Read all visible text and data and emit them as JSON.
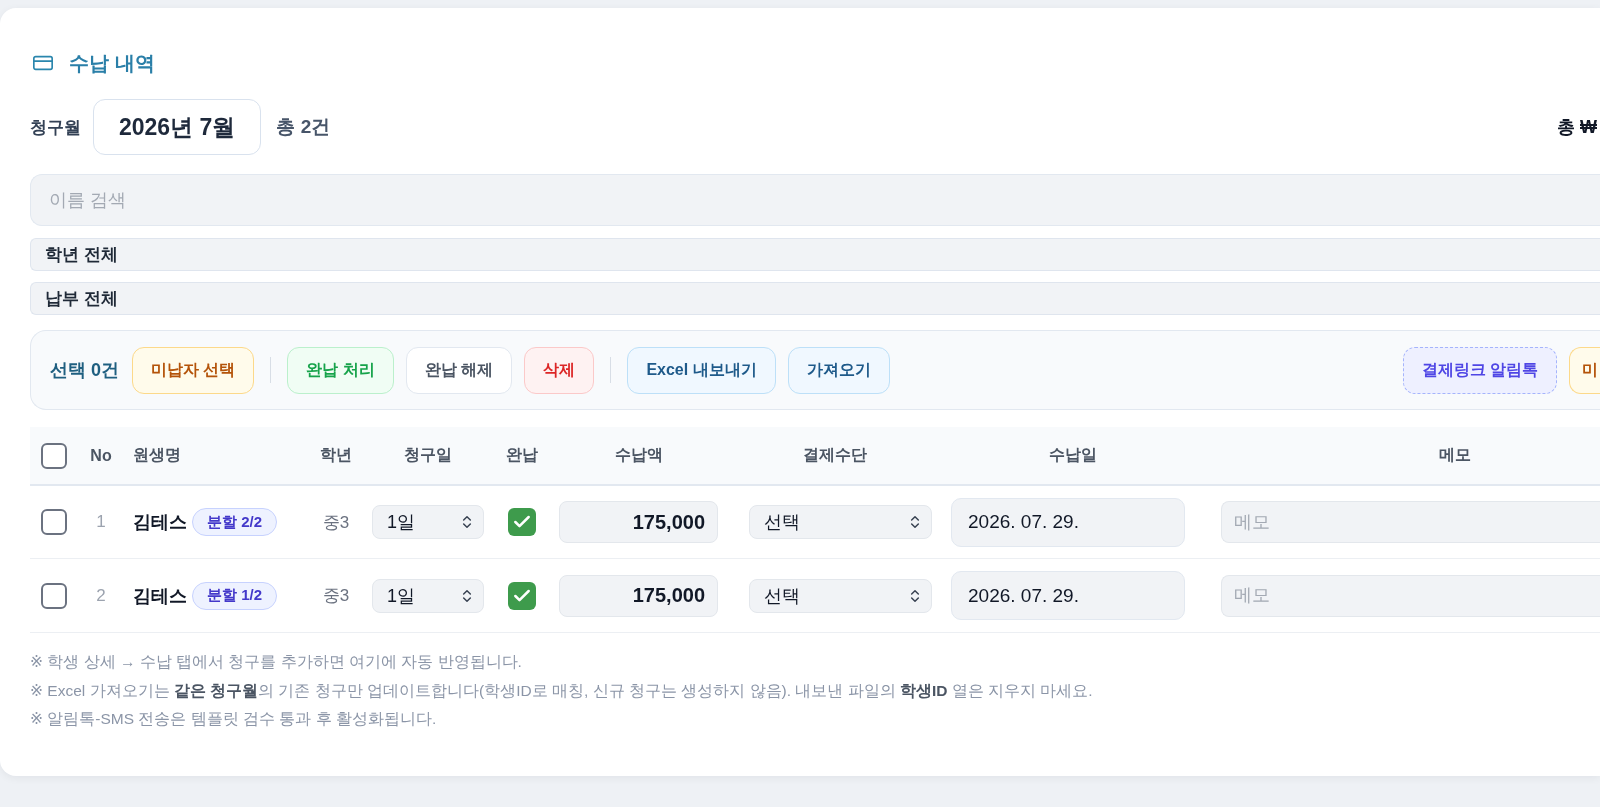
{
  "section": {
    "title": "수납 내역"
  },
  "period": {
    "label": "청구월",
    "value": "2026년 7월",
    "count": "총 2건",
    "total": "총 ₩"
  },
  "filters": {
    "search": {
      "placeholder": "이름 검색"
    },
    "selects": [
      {
        "value": "학년 전체"
      },
      {
        "value": "납부 전체"
      }
    ]
  },
  "toolbar": {
    "selection": "선택 0건",
    "groups": [
      [
        {
          "label": "미납자 선택",
          "kind": "warning"
        }
      ],
      [
        {
          "label": "완납 처리",
          "kind": "success"
        },
        {
          "label": "완납 해제",
          "kind": "neutral"
        },
        {
          "label": "삭제",
          "kind": "danger"
        }
      ],
      [
        {
          "label": "Excel 내보내기",
          "kind": "info"
        },
        {
          "label": "가져오기",
          "kind": "info"
        }
      ]
    ],
    "right": [
      {
        "label": "결제링크 알림톡",
        "kind": "link"
      },
      {
        "label": "미",
        "kind": "warning"
      }
    ]
  },
  "table": {
    "select_all": {
      "checked": false
    },
    "columns": [
      "No",
      "원생명",
      "학년",
      "청구일",
      "완납",
      "수납액",
      "결제수단",
      "수납일",
      "메모"
    ],
    "rows": [
      {
        "checked": false,
        "no": "1",
        "name": "김테스",
        "badge": "분할 2/2",
        "grade": "중3",
        "day": "1일",
        "paid": true,
        "amount": "175,000",
        "method": "선택",
        "date": "2026. 07. 29.",
        "memo": {
          "placeholder": "메모"
        }
      },
      {
        "checked": false,
        "no": "2",
        "name": "김테스",
        "badge": "분할 1/2",
        "grade": "중3",
        "day": "1일",
        "paid": true,
        "amount": "175,000",
        "method": "선택",
        "date": "2026. 07. 29.",
        "memo": {
          "placeholder": "메모"
        }
      }
    ]
  },
  "notes": [
    "※ 학생 상세 → 수납 탭에서 청구를 추가하면 여기에 자동 반영됩니다.",
    "※ Excel 가져오기는 **같은 청구월**의 기존 청구만 업데이트합니다(학생ID로 매칭, 신규 청구는 생성하지 않음). 내보낸 파일의 **학생ID** 열은 지우지 마세요.",
    "※ 알림톡-SMS 전송은 템플릿 검수 통과 후 활성화됩니다."
  ]
}
